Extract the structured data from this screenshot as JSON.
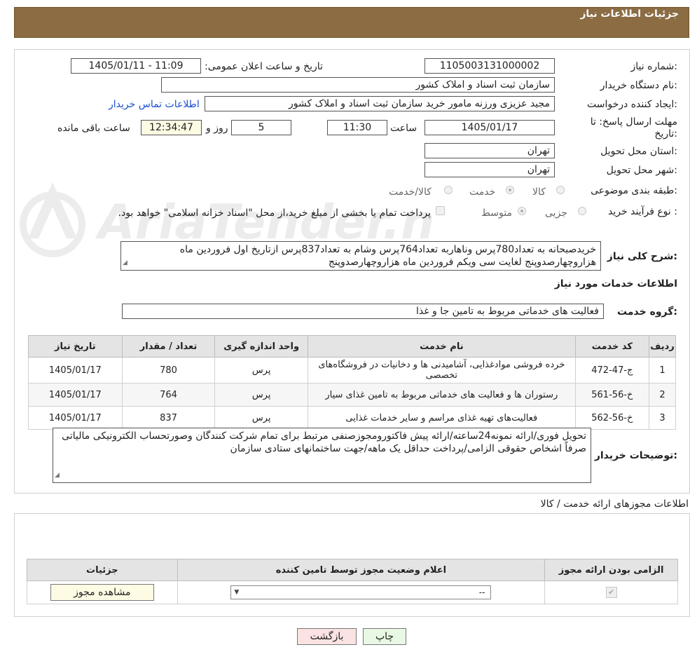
{
  "header": {
    "title": "جزئیات اطلاعات نیاز"
  },
  "form": {
    "need_number_label": "شماره نیاز:",
    "need_number": "1105003131000002",
    "announce_label": "تاریخ و ساعت اعلان عمومی:",
    "announce_value": "1405/01/11 - 11:09",
    "buyer_org_label": "نام دستگاه خریدار:",
    "buyer_org": "سازمان ثبت اسناد و املاک کشور",
    "requester_label": "ایجاد کننده درخواست:",
    "requester": "مجید عزیزی ورزنه مامور خرید سازمان ثبت اسناد و املاک کشور",
    "contact_link": "اطلاعات تماس خریدار",
    "deadline_label_1": "مهلت ارسال پاسخ: تا",
    "deadline_label_2": "تاریخ:",
    "deadline_date": "1405/01/17",
    "time_label": "ساعت",
    "deadline_time": "11:30",
    "days_value": "5",
    "days_label": "روز و",
    "remaining_time": "12:34:47",
    "remaining_label": "ساعت باقی مانده",
    "province_label": "استان محل تحویل:",
    "province": "تهران",
    "city_label": "شهر محل تحویل:",
    "city": "تهران",
    "category_label": "طبقه بندی موضوعی:",
    "category_options": [
      "کالا",
      "خدمت",
      "کالا/خدمت"
    ],
    "category_selected": "خدمت",
    "process_label": "نوع فرآیند خرید :",
    "process_options": [
      "جزیی",
      "متوسط"
    ],
    "process_selected": "متوسط",
    "payment_note": "پرداخت تمام یا بخشی از مبلغ خرید،از محل \"اسناد خزانه اسلامی\" خواهد بود.",
    "summary_label": "شرح کلی نیاز:",
    "summary_text": "خریدصبحانه به تعداد780پرس وناهاربه تعداد764پرس وشام به تعداد837پرس ازتاریخ اول فروردین ماه هزاروچهارصدوپنج لغایت سی ویکم فروردین ماه هزاروچهارصدوپنج"
  },
  "services": {
    "section_title": "اطلاعات خدمات مورد نیاز",
    "group_label": "گروه خدمت:",
    "group_value": "فعالیت های خدماتی مربوط به تامین جا و غذا",
    "columns": [
      "ردیف",
      "کد خدمت",
      "نام خدمت",
      "واحد اندازه گیری",
      "تعداد / مقدار",
      "تاریخ نیاز"
    ],
    "rows": [
      {
        "idx": "1",
        "code": "ج-47-472",
        "name": "خرده فروشی موادغذایی، آشامیدنی ها و دخانیات در فروشگاه‌های تخصصی",
        "unit": "پرس",
        "qty": "780",
        "date": "1405/01/17"
      },
      {
        "idx": "2",
        "code": "خ-56-561",
        "name": "رستوران ها و فعالیت های خدماتی مربوط به تامین غذای سیار",
        "unit": "پرس",
        "qty": "764",
        "date": "1405/01/17"
      },
      {
        "idx": "3",
        "code": "خ-56-562",
        "name": "فعالیت‌های تهیه غذای مراسم و سایر خدمات غذایی",
        "unit": "پرس",
        "qty": "837",
        "date": "1405/01/17"
      }
    ]
  },
  "buyer_notes": {
    "label": "توضیحات خریدار:",
    "text": "تحویل فوری/ارائه نمونه24ساعته/ارائه پیش فاکتورومجوزصنفی مرتبط برای تمام شرکت کنندگان وصورتحساب الکترونیکی مالیاتی صرفاً اشخاص حقوقی الزامی/پرداخت حداقل یک ماهه/جهت ساختمانهای ستادی سازمان"
  },
  "permits": {
    "title": "اطلاعات مجوزهای ارائه خدمت / کالا",
    "columns": [
      "الزامی بودن ارائه مجوز",
      "اعلام وضعیت مجوز توسط تامین کننده",
      "جزئیات"
    ],
    "select_value": "--",
    "view_button": "مشاهده مجوز"
  },
  "buttons": {
    "print": "چاپ",
    "back": "بازگشت"
  },
  "watermark": {
    "text": "AriaTender.neT"
  },
  "colors": {
    "header_bg": "#8b6c43",
    "link": "#1a4fd0",
    "back_btn_bg": "#fbe3e3",
    "print_btn_bg": "#e9f8e4",
    "view_btn_bg": "#fefbe4"
  }
}
